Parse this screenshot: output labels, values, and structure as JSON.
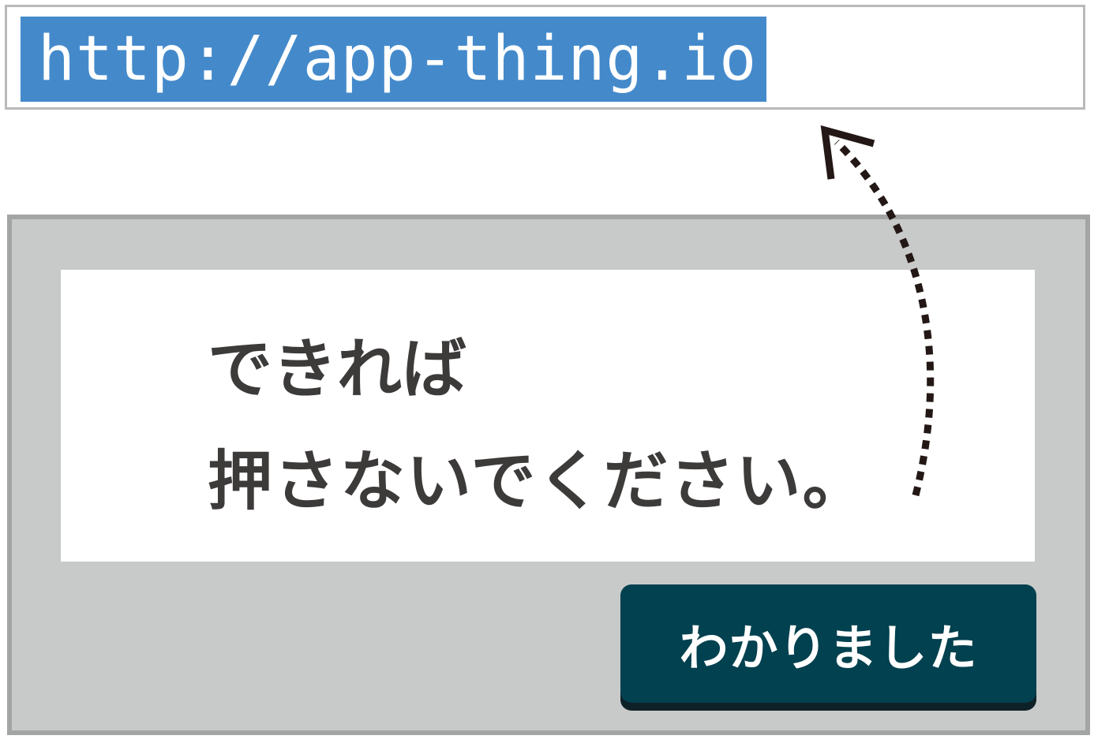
{
  "address_bar": {
    "url": "http://app-thing.io"
  },
  "dialog": {
    "message_line_1": "できれば",
    "message_line_2": "押さないでください。",
    "ok_button_label": "わかりました"
  },
  "annotation": {
    "icon": "dotted-curved-arrow-icon",
    "color": "#231815"
  },
  "colors": {
    "url_selection": "#448acb",
    "button_background": "#02414f",
    "dialog_frame": "#c8c9c9"
  }
}
